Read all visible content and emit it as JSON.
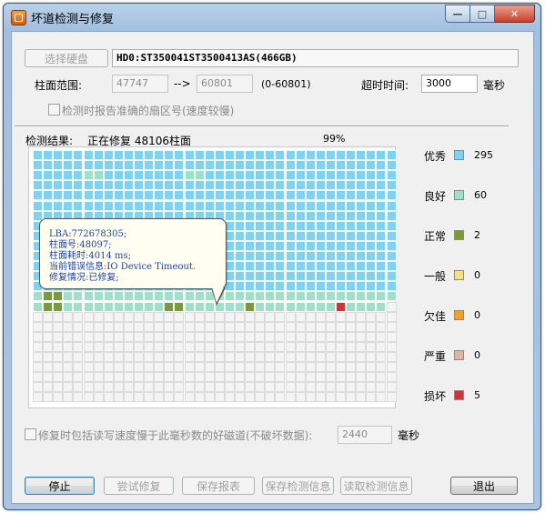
{
  "window": {
    "title": "坏道检测与修复",
    "min_icon": "minimize-icon",
    "max_icon": "maximize-icon",
    "close_icon": "close-icon"
  },
  "disk": {
    "select_button": "选择硬盘",
    "name": "HD0:ST350041ST3500413AS(466GB)"
  },
  "cylinder_range": {
    "label": "柱面范围:",
    "start": "47747",
    "arrow": "-->",
    "end": "60801",
    "hint": "(0-60801)"
  },
  "timeout": {
    "label": "超时时间:",
    "value": "3000",
    "unit": "毫秒"
  },
  "report_sector": {
    "label": "检测时报告准确的扇区号(速度较慢)",
    "checked": false
  },
  "result": {
    "label": "检测结果:",
    "status": "正在修复 48106柱面",
    "progress_text": "99%",
    "progress": 0.99
  },
  "legend": [
    {
      "label": "优秀",
      "color": "#7fd3f0",
      "count": "295"
    },
    {
      "label": "良好",
      "color": "#9ee0c8",
      "count": "60"
    },
    {
      "label": "正常",
      "color": "#7b9a3a",
      "count": "2"
    },
    {
      "label": "一般",
      "color": "#f5e08a",
      "count": "0"
    },
    {
      "label": "欠佳",
      "color": "#f0a030",
      "count": "0"
    },
    {
      "label": "严重",
      "color": "#d8b8a0",
      "count": "0"
    },
    {
      "label": "损坏",
      "color": "#c83838",
      "count": "5"
    }
  ],
  "grid": {
    "cols": 36,
    "rows": 25,
    "rows_data": [
      "AAAAAAAAAAAAAAAAAAAAAAAAAAAAAAAAAAAA",
      "AAAAAAAAAAAAAAAAAAAAAAAAAAAAAAAAAAAA",
      "AAAAABBAAAAAAAABBAAAAAAAAAAAAAAAAAAA",
      "AAAAAAAAAAAAAAAAAAAAAAAAAAAAAAAAAAAA",
      "AAAAAAAAAAAAAAAAAAAAAAAAAAAAAAAAAAAA",
      "AAAAAAAAAAAAAAAAAAAAAAAAAAAAAAAAAAAA",
      "AAAAAAAAAAAAAAAAAAAAAAAAAAAAAAAAAAAA",
      "AAAAAAAAAAAAAAAAAAAAAAAAAAAAAAAAAAAA",
      "AAAAAAAAAAAAAAAAAAAAAAAAAAAAAAAAAAAA",
      "AAAAAAAAAAAAAAAAAAAAAAAAAAAAAAAAAAAA",
      "AAAAAAAAAAAAAAAAAAAAAAAAAAAAAAAAAAAA",
      "AAAAAAAAAAAAAAAAAAAAAAAAAAAAAAAAAAAA",
      "AAAAAAAAAAAAAAAAAAAAAAAAAAAAAAAAAAAA",
      "AAAAAAAAAAAAAAAAAAAAAAAAAAAAAAAAAAAA",
      "BCCBBBBBBBBBBBBBBBBBBBBBBBBBBBBBBBBB",
      "BCCBBBBBBBBBBCCBBBBBBCBBBBBBBBDBBBBE",
      "EEEEEEEEEEEEEEEEEEEEEEEEEEEEEEEEEEEE",
      "EEEEEEEEEEEEEEEEEEEEEEEEEEEEEEEEEEEE",
      "EEEEEEEEEEEEEEEEEEEEEEEEEEEEEEEEEEEE",
      "EEEEEEEEEEEEEEEEEEEEEEEEEEEEEEEEEEEE",
      "EEEEEEEEEEEEEEEEEEEEEEEEEEEEEEEEEEEE",
      "EEEEEEEEEEEEEEEEEEEEEEEEEEEEEEEEEEEE",
      "EEEEEEEEEEEEEEEEEEEEEEEEEEEEEEEEEEEE",
      "EEEEEEEEEEEEEEEEEEEEEEEEEEEEEEEEEEEE",
      "EEEEEEEEEEEEEEEEEEEEEEEEEEEEEEEEEEEE"
    ],
    "key": {
      "A": "#7fd3f0",
      "B": "#9ee0c8",
      "C": "#7b9a3a",
      "D": "#c83838",
      "E": "#f4f4f4"
    }
  },
  "tooltip": {
    "lines": [
      "LBA:772678305;",
      "柱面号:48097;",
      "柱面耗时:4014 ms;",
      "当前错误信息:IO Device Timeout.",
      "修复情况:已修复;"
    ]
  },
  "slow_track": {
    "label": "修复时包括读写速度慢于此毫秒数的好磁道(不破坏数据):",
    "value": "2440",
    "unit": "毫秒",
    "checked": false
  },
  "buttons": {
    "stop": "停止",
    "try_repair": "尝试修复",
    "save_report": "保存报表",
    "save_info": "保存检测信息",
    "load_info": "读取检测信息",
    "exit": "退出"
  }
}
